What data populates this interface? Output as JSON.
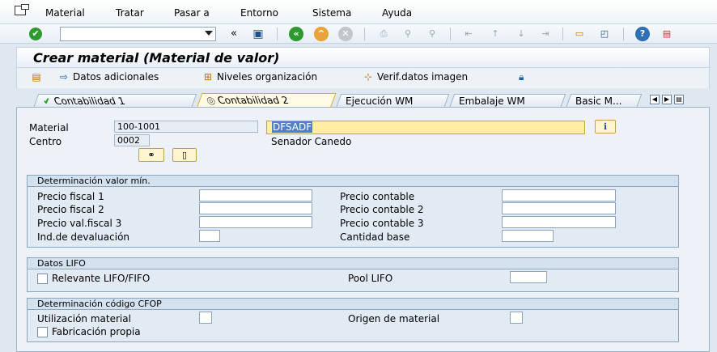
{
  "menu": {
    "items": [
      "Material",
      "Tratar",
      "Pasar a",
      "Entorno",
      "Sistema",
      "Ayuda"
    ]
  },
  "toolbar": {
    "command_value": "",
    "icons": [
      "check-icon",
      "dropdown-icon",
      "back-double-icon",
      "save-icon",
      "back-icon",
      "exit-icon",
      "cancel-icon",
      "print-icon",
      "find-icon",
      "find-next-icon",
      "first-page-icon",
      "prev-page-icon",
      "next-page-icon",
      "last-page-icon",
      "new-session-icon",
      "shortcut-icon",
      "help-icon",
      "layout-icon"
    ]
  },
  "title": "Crear material (Material de valor)",
  "app_toolbar": {
    "additional_data": "Datos adicionales",
    "org_levels": "Niveles organización",
    "check_screen": "Verif.datos imagen"
  },
  "tabs": [
    "Contabilidad 1",
    "Contabilidad 2",
    "Ejecución WM",
    "Embalaje WM",
    "Basic M..."
  ],
  "active_tab": 1,
  "header": {
    "material_label": "Material",
    "material_value": "100-1001",
    "description_selected": "DFSADF",
    "plant_label": "Centro",
    "plant_value": "0002",
    "plant_name": "Senador Canedo"
  },
  "valuation": {
    "title": "Determinación valor mín.",
    "tax_price_1": "Precio fiscal 1",
    "tax_price_2": "Precio fiscal 2",
    "tax_price_3": "Precio val.fiscal 3",
    "devaluation": "Ind.de devaluación",
    "commercial_price_1": "Precio contable",
    "commercial_price_2": "Precio contable 2",
    "commercial_price_3": "Precio contable 3",
    "base_quantity": "Cantidad base"
  },
  "lifo": {
    "title": "Datos LIFO",
    "relevant": "Relevante LIFO/FIFO",
    "pool": "Pool LIFO"
  },
  "cfop": {
    "title": "Determinación código CFOP",
    "usage": "Utilización material",
    "origin": "Origen de material",
    "in_house": "Fabricación propia"
  },
  "colors": {
    "accent": "#e6a52a",
    "background": "#dfe8f1",
    "header_bar": "#d4e1ee",
    "selection": "#4f80c4",
    "required": "#ffeea3"
  }
}
